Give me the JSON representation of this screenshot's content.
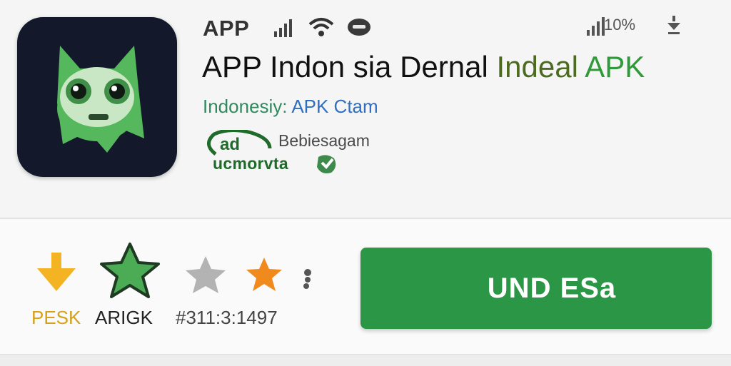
{
  "status_bar": {
    "app_label": "APP",
    "battery_text": "10%",
    "icons": [
      "signal-bars-icon",
      "wifi-icon",
      "chat-bubble-icon",
      "signal-bars-icon",
      "download-arrow-icon"
    ]
  },
  "app": {
    "title_main": "APP Indon sia Dernal ",
    "title_accent": "Indeal ",
    "title_apk": "APK",
    "subtitle_prefix": "Indonesiy: ",
    "subtitle_link": "APK Ctam"
  },
  "developer": {
    "logo_text": "ad",
    "line1": "Bebiesagam",
    "line2": "ucmorvta"
  },
  "stats": {
    "items": [
      {
        "icon": "download-arrow-icon",
        "label": "PESK"
      },
      {
        "icon": "green-star-icon",
        "label": "ARIGK"
      },
      {
        "icon": "gray-star-icon",
        "label": "#311:3:1497"
      },
      {
        "icon": "orange-star-icon",
        "label": ""
      },
      {
        "icon": "more-dots-icon",
        "label": ""
      }
    ]
  },
  "install_button": {
    "label": "UND ESa"
  },
  "colors": {
    "brand_green": "#2c9647",
    "icon_bg": "#13182a",
    "mascot_green": "#55b85c",
    "accent_yellow": "#f3b322",
    "accent_orange": "#f18a1d"
  }
}
